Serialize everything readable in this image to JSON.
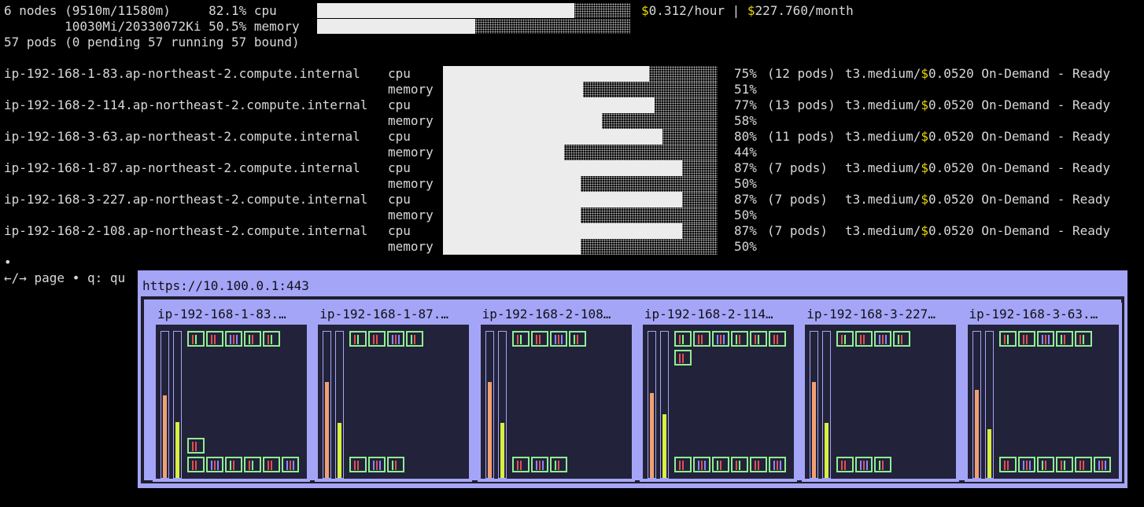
{
  "summary": {
    "line1_prefix": "6 nodes (9510m/11580m)     82.1% cpu",
    "line2_prefix": "        10030Mi/20330072Ki 50.5% memory",
    "line3": "57 pods (0 pending 57 running 57 bound)",
    "cpu_pct": 82.1,
    "mem_pct": 50.5,
    "cost": {
      "d1": "$",
      "hour": "0.312",
      "hour_suffix": "/hour | ",
      "d2": "$",
      "month": "227.760",
      "month_suffix": "/month"
    }
  },
  "nodes": [
    {
      "name": "ip-192-168-1-83.ap-northeast-2.compute.internal",
      "cpu": 75,
      "mem": 51,
      "pods": "(12 pods)",
      "instance": "t3.medium/",
      "price_d": "$",
      "price": "0.0520",
      "status": " On-Demand - Ready"
    },
    {
      "name": "ip-192-168-2-114.ap-northeast-2.compute.internal",
      "cpu": 77,
      "mem": 58,
      "pods": "(13 pods)",
      "instance": "t3.medium/",
      "price_d": "$",
      "price": "0.0520",
      "status": " On-Demand - Ready"
    },
    {
      "name": "ip-192-168-3-63.ap-northeast-2.compute.internal",
      "cpu": 80,
      "mem": 44,
      "pods": "(11 pods)",
      "instance": "t3.medium/",
      "price_d": "$",
      "price": "0.0520",
      "status": " On-Demand - Ready"
    },
    {
      "name": "ip-192-168-1-87.ap-northeast-2.compute.internal",
      "cpu": 87,
      "mem": 50,
      "pods": "(7 pods) ",
      "instance": "t3.medium/",
      "price_d": "$",
      "price": "0.0520",
      "status": " On-Demand - Ready"
    },
    {
      "name": "ip-192-168-3-227.ap-northeast-2.compute.internal",
      "cpu": 87,
      "mem": 50,
      "pods": "(7 pods) ",
      "instance": "t3.medium/",
      "price_d": "$",
      "price": "0.0520",
      "status": " On-Demand - Ready"
    },
    {
      "name": "ip-192-168-2-108.ap-northeast-2.compute.internal",
      "cpu": 87,
      "mem": 50,
      "pods": "(7 pods) ",
      "instance": "t3.medium/",
      "price_d": "$",
      "price": "0.0520",
      "status": " On-Demand - Ready"
    }
  ],
  "labels": {
    "cpu": "cpu",
    "memory": "memory"
  },
  "footer": {
    "dot": "•",
    "help": "←/→ page • q: qu"
  },
  "viz": {
    "url": "https://10.100.0.1:443",
    "cards": [
      {
        "title": "ip-192-168-1-83.…",
        "cpu": 75,
        "mem": 51,
        "top_pods": 5,
        "bottom_pods": 6,
        "extra_pod": true
      },
      {
        "title": "ip-192-168-1-87.…",
        "cpu": 87,
        "mem": 50,
        "top_pods": 4,
        "bottom_pods": 3,
        "extra_pod": false
      },
      {
        "title": "ip-192-168-2-108…",
        "cpu": 87,
        "mem": 50,
        "top_pods": 4,
        "bottom_pods": 3,
        "extra_pod": false
      },
      {
        "title": "ip-192-168-2-114…",
        "cpu": 77,
        "mem": 58,
        "top_pods": 6,
        "bottom_pods": 6,
        "extra_pod": true
      },
      {
        "title": "ip-192-168-3-227…",
        "cpu": 87,
        "mem": 50,
        "top_pods": 4,
        "bottom_pods": 3,
        "extra_pod": false
      },
      {
        "title": "ip-192-168-3-63.…",
        "cpu": 80,
        "mem": 44,
        "top_pods": 5,
        "bottom_pods": 6,
        "extra_pod": false
      }
    ],
    "colors": {
      "cpu": "#f0a070",
      "mem": "#d8f040",
      "pod_border": "#90ee90",
      "stripe_red": "#e05050",
      "stripe_green": "#80ff80",
      "stripe_blue": "#8888ff"
    }
  }
}
